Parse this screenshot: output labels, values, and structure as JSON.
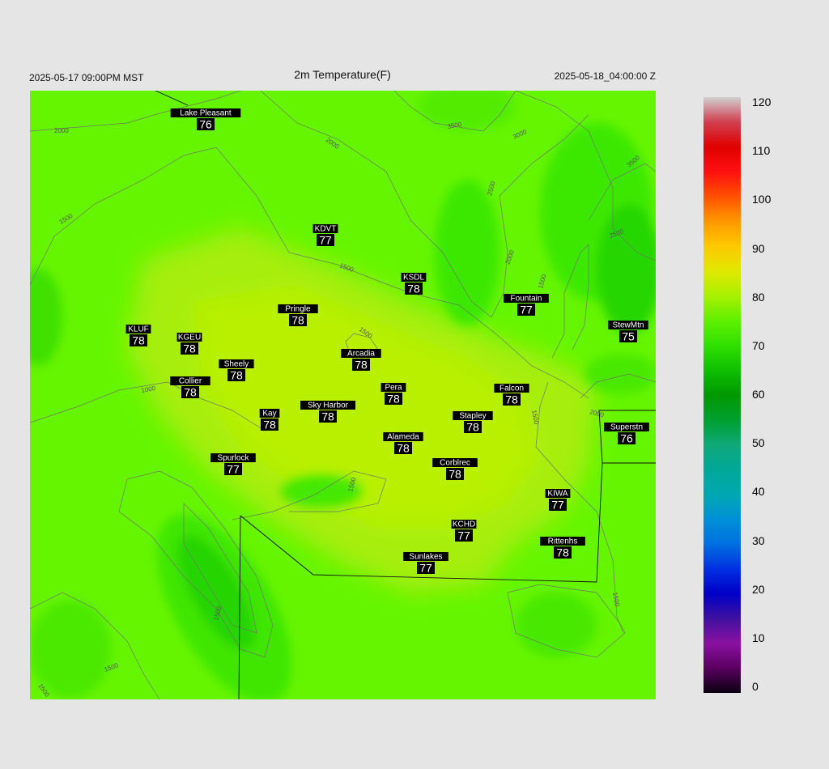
{
  "header": {
    "local_time": "2025-05-17 09:00PM MST",
    "title": "2m Temperature(F)",
    "utc_time": "2025-05-18_04:00:00 Z"
  },
  "colorbar": {
    "min": 0,
    "max": 120,
    "ticks": [
      "120",
      "110",
      "100",
      "90",
      "80",
      "70",
      "60",
      "50",
      "40",
      "30",
      "20",
      "10",
      "0"
    ]
  },
  "stations": [
    {
      "name": "Lake Pleasant",
      "temp": "76"
    },
    {
      "name": "KDVT",
      "temp": "77"
    },
    {
      "name": "KSDL",
      "temp": "78"
    },
    {
      "name": "Fountain",
      "temp": "77"
    },
    {
      "name": "StewMtn",
      "temp": "75"
    },
    {
      "name": "Pringle",
      "temp": "78"
    },
    {
      "name": "KLUF",
      "temp": "78"
    },
    {
      "name": "KGEU",
      "temp": "78"
    },
    {
      "name": "Arcadia",
      "temp": "78"
    },
    {
      "name": "Sheely",
      "temp": "78"
    },
    {
      "name": "Collier",
      "temp": "78"
    },
    {
      "name": "Pera",
      "temp": "78"
    },
    {
      "name": "Falcon",
      "temp": "78"
    },
    {
      "name": "Sky Harbor",
      "temp": "78"
    },
    {
      "name": "Kay",
      "temp": "78"
    },
    {
      "name": "Stapley",
      "temp": "78"
    },
    {
      "name": "Superstn",
      "temp": "76"
    },
    {
      "name": "Alameda",
      "temp": "78"
    },
    {
      "name": "Spurlock",
      "temp": "77"
    },
    {
      "name": "Corblrec",
      "temp": "78"
    },
    {
      "name": "KIWA",
      "temp": "77"
    },
    {
      "name": "KCHD",
      "temp": "77"
    },
    {
      "name": "Rittenhs",
      "temp": "78"
    },
    {
      "name": "Sunlakes",
      "temp": "77"
    }
  ],
  "contour_labels": [
    "2000",
    "1500",
    "1000",
    "2500",
    "3000",
    "3500"
  ]
}
